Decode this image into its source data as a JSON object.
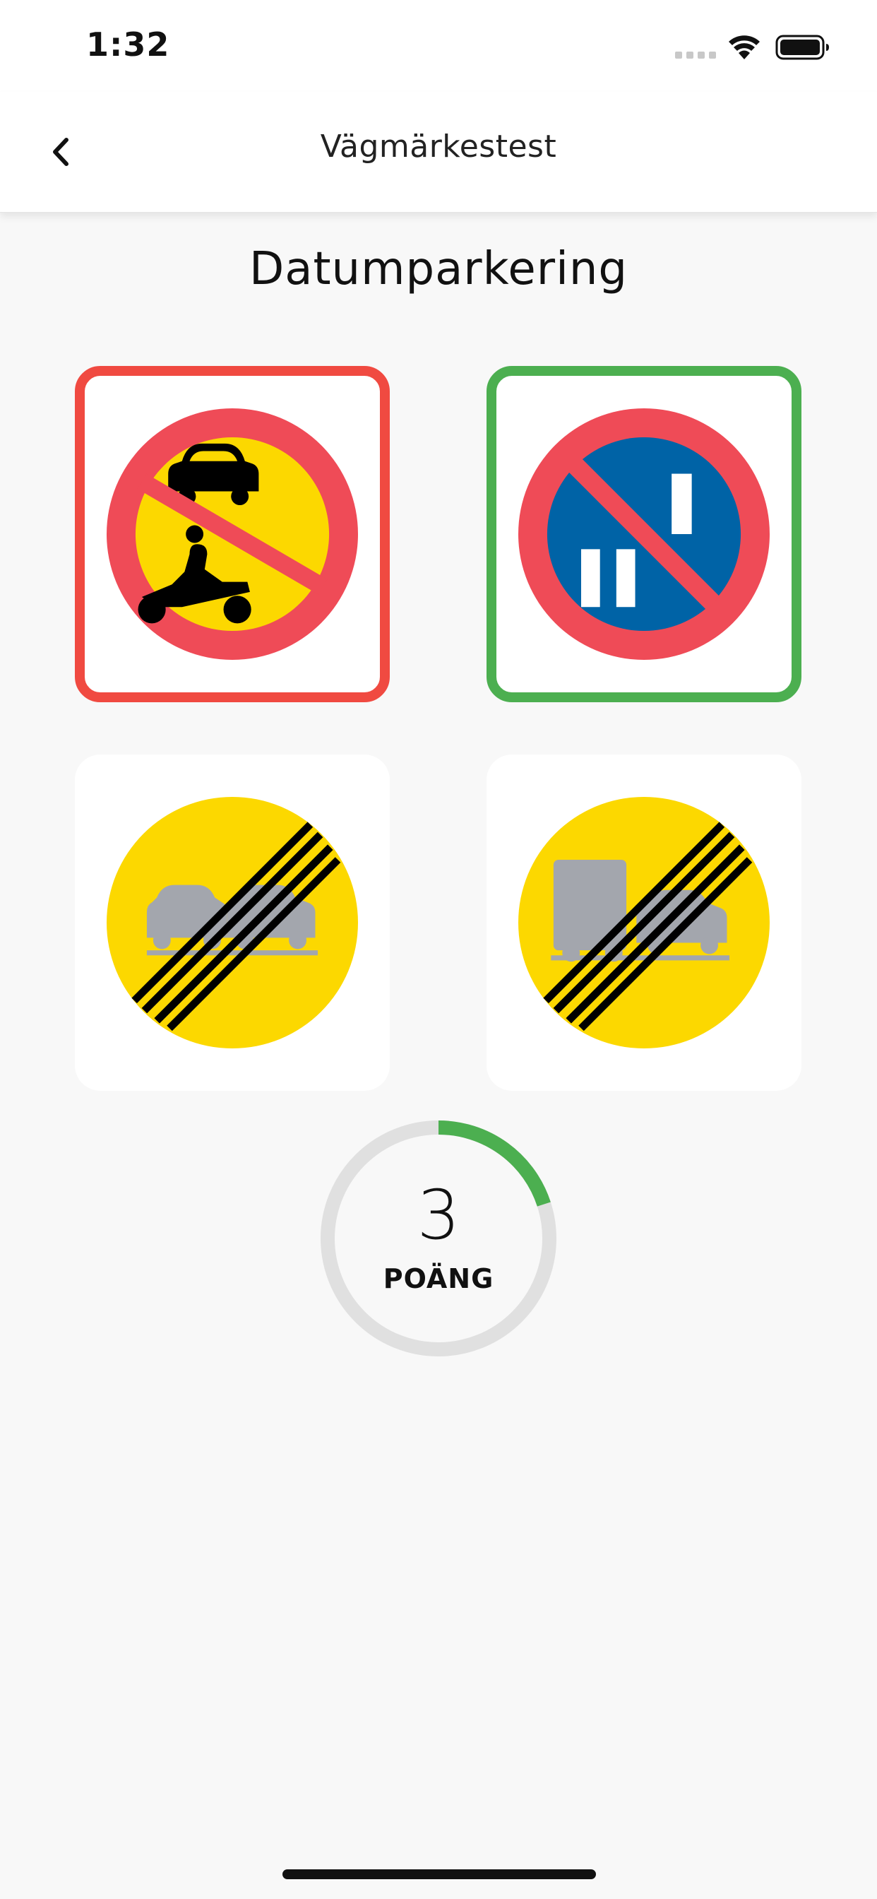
{
  "status_bar": {
    "time": "1:32"
  },
  "nav": {
    "title": "Vägmärkestest",
    "back_icon": "chevron-left-icon"
  },
  "question": {
    "title": "Datumparkering"
  },
  "options": [
    {
      "sign": "no-motor-vehicles-except-moped-sign",
      "state": "wrong",
      "border_color": "#f04a41"
    },
    {
      "sign": "date-parking-sign",
      "state": "correct",
      "border_color": "#4caf50"
    },
    {
      "sign": "end-no-overtaking-sign",
      "state": "unselected"
    },
    {
      "sign": "end-no-overtaking-heavy-vehicle-sign",
      "state": "unselected"
    }
  ],
  "score": {
    "value": "3",
    "label": "POÄNG",
    "progress_fraction": 0.2,
    "progress_color": "#4caf50",
    "track_color": "#e0e0e0"
  },
  "colors": {
    "sign_red": "#ef4b57",
    "sign_yellow": "#fcd800",
    "sign_blue": "#0063a6"
  }
}
